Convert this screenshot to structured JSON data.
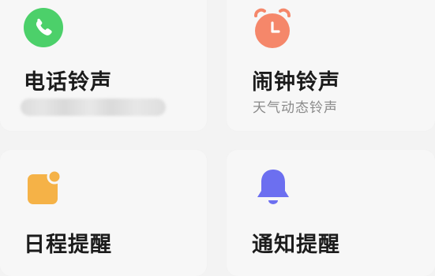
{
  "cards": [
    {
      "title": "电话铃声",
      "subtitle": "",
      "icon": "phone-icon",
      "icon_color": "#4cd06a"
    },
    {
      "title": "闹钟铃声",
      "subtitle": "天气动态铃声",
      "icon": "alarm-clock-icon",
      "icon_color": "#f5876a"
    },
    {
      "title": "日程提醒",
      "subtitle": "",
      "icon": "calendar-badge-icon",
      "icon_color": "#f5b247"
    },
    {
      "title": "通知提醒",
      "subtitle": "",
      "icon": "bell-icon",
      "icon_color": "#6c6ff0"
    }
  ]
}
